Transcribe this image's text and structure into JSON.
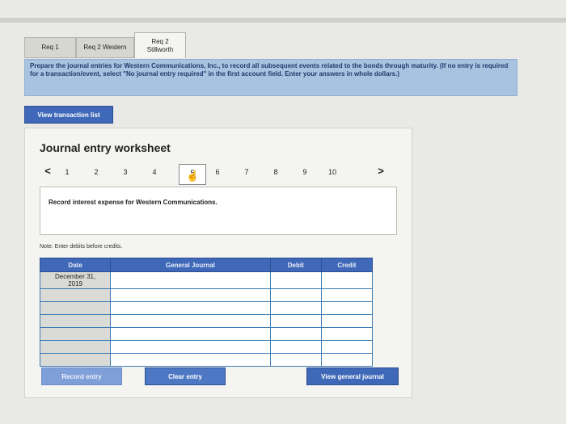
{
  "tabs": [
    {
      "label": "Req 1"
    },
    {
      "label": "Req 2 Western"
    },
    {
      "label_line1": "Req 2",
      "label_line2": "Stillworth"
    }
  ],
  "instructions": "Prepare the journal entries for Western Communications, Inc., to record all subsequent events related to the bonds through maturity. (If no entry is required for a transaction/event, select \"No journal entry required\" in the first account field. Enter your answers in whole dollars.)",
  "view_transaction_list_label": "View transaction list",
  "worksheet": {
    "title": "Journal entry worksheet",
    "pager": {
      "prev": "<",
      "pages": [
        "1",
        "2",
        "3",
        "4",
        "5",
        "6",
        "7",
        "8",
        "9",
        "10"
      ],
      "current": "5",
      "next": ">"
    },
    "description": "Record interest expense for Western Communications.",
    "note": "Note: Enter debits before credits."
  },
  "journal_table": {
    "headers": [
      "Date",
      "General Journal",
      "Debit",
      "Credit"
    ],
    "first_date_line1": "December 31,",
    "first_date_line2": "2019"
  },
  "buttons": {
    "record": "Record entry",
    "clear": "Clear entry",
    "view_general": "View general journal"
  }
}
